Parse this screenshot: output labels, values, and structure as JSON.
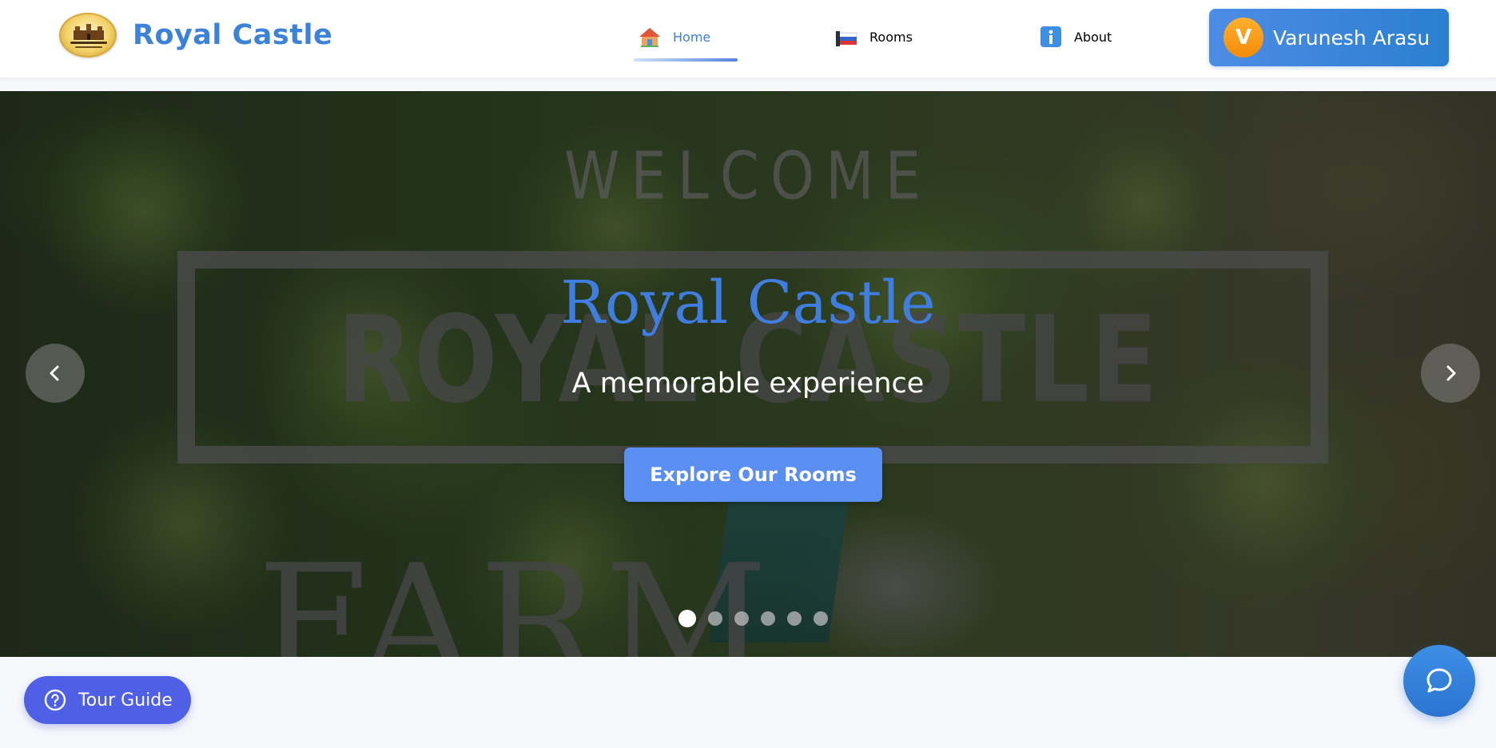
{
  "brand": {
    "name": "Royal Castle",
    "logo_icon": "castle-logo-icon"
  },
  "nav": {
    "items": [
      {
        "label": "Home",
        "icon": "house-icon",
        "active": true
      },
      {
        "label": "Rooms",
        "icon": "bed-icon",
        "active": false
      },
      {
        "label": "About",
        "icon": "info-icon",
        "active": false
      }
    ]
  },
  "user": {
    "initial": "V",
    "name": "Varunesh Arasu"
  },
  "hero": {
    "title": "Royal Castle",
    "subtitle": "A memorable experience",
    "cta_label": "Explore Our Rooms",
    "watermark": {
      "welcome": "WELCOME",
      "royal_castle": "ROYAL CASTLE",
      "farm": "FARM"
    },
    "slides_count": 6,
    "active_slide": 1
  },
  "floating": {
    "tour_label": "Tour Guide"
  },
  "colors": {
    "accent": "#3b82d8",
    "cta": "#5a8ef0",
    "tour": "#4f5fe6",
    "avatar": "#f7a21c"
  }
}
